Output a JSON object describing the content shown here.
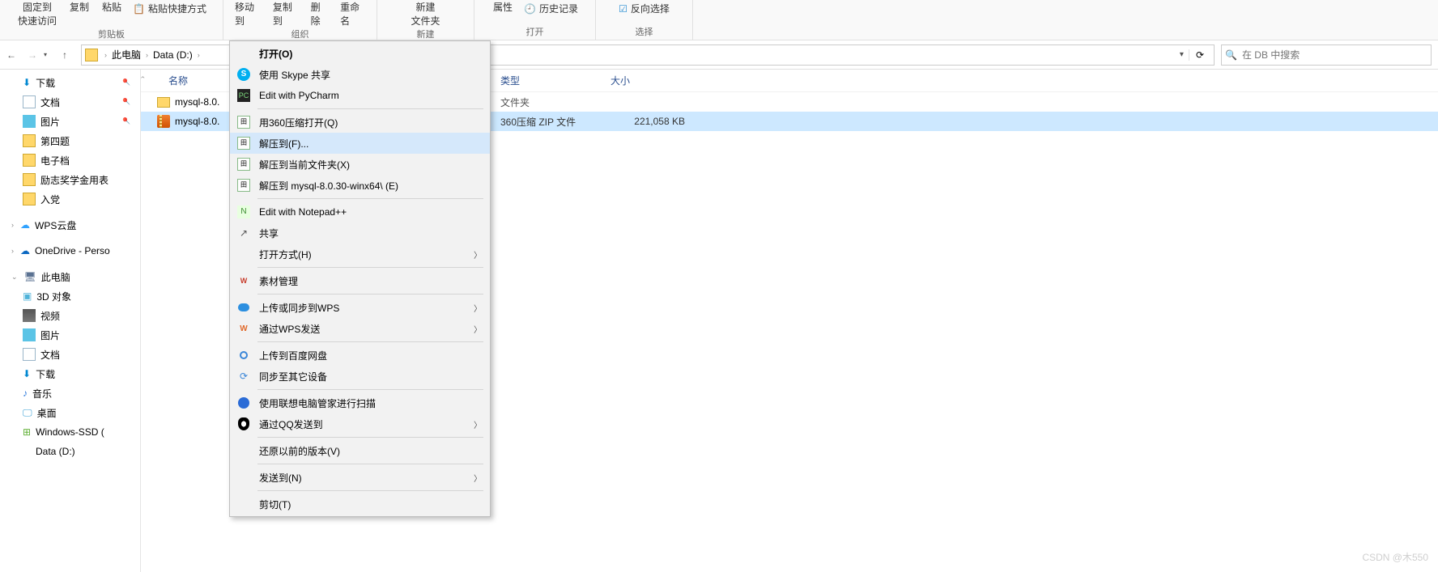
{
  "ribbon": {
    "group_clipboard": "剪贴板",
    "group_organize": "组织",
    "group_new": "新建",
    "group_open": "打开",
    "group_select": "选择",
    "pin_to": "固定到",
    "copy": "复制",
    "paste": "粘贴",
    "paste_shortcut": "粘贴快捷方式",
    "fast_access": "快速访问",
    "move_to": "移动到",
    "copy_to": "复制到",
    "delete": "删除",
    "rename": "重命名",
    "new_folder": "新建",
    "new_folder2": "文件夹",
    "properties": "属性",
    "history": "历史记录",
    "invert": "反向选择"
  },
  "nav": {
    "crumb1": "此电脑",
    "crumb2": "Data (D:)",
    "search_placeholder": "在 DB 中搜索"
  },
  "cols": {
    "name": "名称",
    "type": "类型",
    "size": "大小"
  },
  "rows": {
    "r0": {
      "name": "mysql-8.0.",
      "type": "文件夹",
      "size": ""
    },
    "r1": {
      "name": "mysql-8.0.",
      "type": "360压缩 ZIP 文件",
      "size": "221,058 KB"
    }
  },
  "sidebar": {
    "downloads": "下载",
    "documents": "文档",
    "pictures": "图片",
    "q4": "第四题",
    "edoc": "电子档",
    "award": "励志奖学金用表",
    "party": "入党",
    "wps": "WPS云盘",
    "onedrive": "OneDrive - Perso",
    "thispc": "此电脑",
    "obj3d": "3D 对象",
    "video": "视频",
    "pictures2": "图片",
    "documents2": "文档",
    "downloads2": "下载",
    "music": "音乐",
    "desktop": "桌面",
    "winssd": "Windows-SSD (",
    "datad": "Data (D:)"
  },
  "ctx": {
    "open": "打开(O)",
    "skype": "使用 Skype 共享",
    "pycharm": "Edit with PyCharm",
    "open360": "用360压缩打开(Q)",
    "extract_to": "解压到(F)...",
    "extract_here": "解压到当前文件夹(X)",
    "extract_named": "解压到 mysql-8.0.30-winx64\\ (E)",
    "npp": "Edit with Notepad++",
    "share": "共享",
    "open_with": "打开方式(H)",
    "material": "素材管理",
    "upload_wps": "上传或同步到WPS",
    "send_wps": "通过WPS发送",
    "baidu": "上传到百度网盘",
    "sync_other": "同步至其它设备",
    "lenovo": "使用联想电脑管家进行扫描",
    "qq": "通过QQ发送到",
    "restore": "还原以前的版本(V)",
    "send_to": "发送到(N)",
    "cut": "剪切(T)"
  },
  "watermark": "CSDN @木550"
}
